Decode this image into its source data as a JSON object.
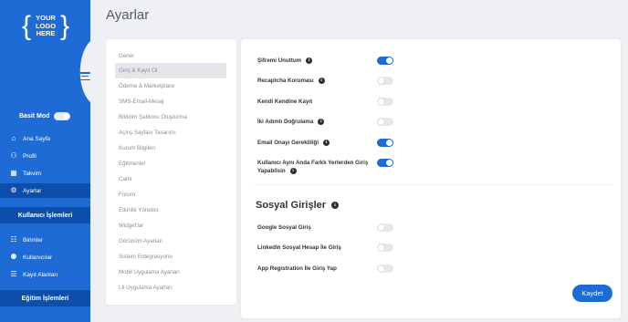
{
  "sidebar": {
    "logo_lines": [
      "YOUR",
      "LOGO",
      "HERE"
    ],
    "basic_mode_label": "Basit Mod",
    "nav_items": [
      {
        "label": "Ana Sayfa",
        "icon": "home-icon"
      },
      {
        "label": "Profil",
        "icon": "user-icon"
      },
      {
        "label": "Takvim",
        "icon": "calendar-icon"
      },
      {
        "label": "Ayarlar",
        "icon": "gear-icon"
      }
    ],
    "section_user_ops": "Kullanıcı İşlemleri",
    "user_ops_items": [
      {
        "label": "Birimler",
        "icon": "units-icon"
      },
      {
        "label": "Kullanıcılar",
        "icon": "users-icon"
      },
      {
        "label": "Kayıt Alanları",
        "icon": "form-icon"
      }
    ],
    "section_edu_ops": "Eğitim İşlemleri",
    "colors": {
      "sidebar": "#1f6bd6",
      "active": "#0e4eab"
    }
  },
  "page": {
    "title": "Ayarlar"
  },
  "menu": {
    "items": [
      "Genel",
      "Giriş & Kayıt Ol",
      "Ödeme & Marketplace",
      "SMS-Email-Mesaj",
      "Bildirim Şablonu Oluşturma",
      "Açılış Sayfası Tasarımı",
      "Kurum Bilgileri",
      "Eğitmenler",
      "Canlı",
      "Forum",
      "Etkinlik Yönetici",
      "Widget'lar",
      "Görünüm Ayarları",
      "Sistem Entegrasyonu",
      "Mobil Uygulama Ayarları",
      "Lti Uygulama Ayarları"
    ],
    "active_index": 1
  },
  "settings": {
    "rows": [
      {
        "label": "Şifremi Unuttum",
        "on": true,
        "info": true
      },
      {
        "label": "Recaptcha Koruması",
        "on": false,
        "info": true
      },
      {
        "label": "Kendi Kendine Kayıt",
        "on": false,
        "info": false
      },
      {
        "label": "İki Adımlı Doğrulama",
        "on": false,
        "info": true
      },
      {
        "label": "Email Onayı Gerekliliği",
        "on": true,
        "info": true
      },
      {
        "label": "Kullanıcı Aynı Anda Farklı Yerlerden Giriş Yapabilsin",
        "on": true,
        "info": true
      }
    ],
    "social_title": "Sosyal Girişler",
    "social_rows": [
      {
        "label": "Google Sosyal Giriş",
        "on": false
      },
      {
        "label": "LinkedIn Sosyal Hesap İle Giriş",
        "on": false
      },
      {
        "label": "App Registration İle Giriş Yap",
        "on": false
      }
    ],
    "save_label": "Kaydet",
    "accent": "#1f6bd6"
  }
}
